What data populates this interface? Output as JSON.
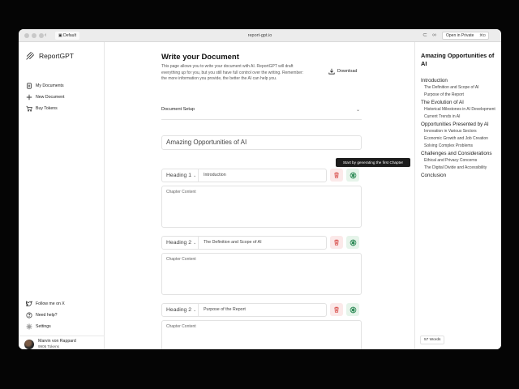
{
  "browser": {
    "tab_label": "Default",
    "url": "report-gpt.io",
    "private_label": "Open in Private",
    "private_shortcut": "⌘D"
  },
  "sidebar": {
    "brand": "ReportGPT",
    "nav": [
      {
        "label": "My Documents",
        "icon": "document-icon"
      },
      {
        "label": "New Document",
        "icon": "plus-icon"
      },
      {
        "label": "Buy Tokens",
        "icon": "cart-icon"
      }
    ],
    "footer_nav": [
      {
        "label": "Follow me on X",
        "icon": "twitter-icon"
      },
      {
        "label": "Need help?",
        "icon": "help-icon"
      },
      {
        "label": "Settings",
        "icon": "gear-icon"
      }
    ],
    "user": {
      "name": "Marvin von Rappard",
      "tokens": "9906 Tokens"
    }
  },
  "main": {
    "title": "Write your Document",
    "intro": "This page allows you to write your document with AI. ReportGPT will draft everything up for you, but you still have full control over the writing. Remember: the more information you provide, the better the AI can help you.",
    "download_label": "Download",
    "setup_label": "Document Setup",
    "doc_title": "Amazing Opportunities of AI",
    "content_placeholder": "Chapter Content",
    "tooltip": "Start by generating the first Chapter",
    "chapters": [
      {
        "level": "Heading 1",
        "name": "Introduction"
      },
      {
        "level": "Heading 2",
        "name": "The Definition and Scope of AI"
      },
      {
        "level": "Heading 2",
        "name": "Purpose of the Report"
      }
    ]
  },
  "outline": {
    "title": "Amazing Opportunities of AI",
    "items": [
      {
        "text": "Introduction",
        "level": 1
      },
      {
        "text": "The Definition and Scope of AI",
        "level": 2
      },
      {
        "text": "Purpose of the Report",
        "level": 2
      },
      {
        "text": "The Evolution of AI",
        "level": 1
      },
      {
        "text": "Historical Milestones in AI Development",
        "level": 2
      },
      {
        "text": "Current Trends in AI",
        "level": 2
      },
      {
        "text": "Opportunities Presented by AI",
        "level": 1
      },
      {
        "text": "Innovation in Various Sectors",
        "level": 2
      },
      {
        "text": "Economic Growth and Job Creation",
        "level": 2
      },
      {
        "text": "Solving Complex Problems",
        "level": 2
      },
      {
        "text": "Challenges and Considerations",
        "level": 1
      },
      {
        "text": "Ethical and Privacy Concerns",
        "level": 2
      },
      {
        "text": "The Digital Divide and Accessibility",
        "level": 2
      },
      {
        "text": "Conclusion",
        "level": 1
      }
    ],
    "word_count": "57 Words"
  },
  "colors": {
    "delete_bg": "#fbe9e9",
    "delete_icon": "#d9534f",
    "generate_bg": "#e6f4ea",
    "generate_icon": "#2e8b57"
  }
}
